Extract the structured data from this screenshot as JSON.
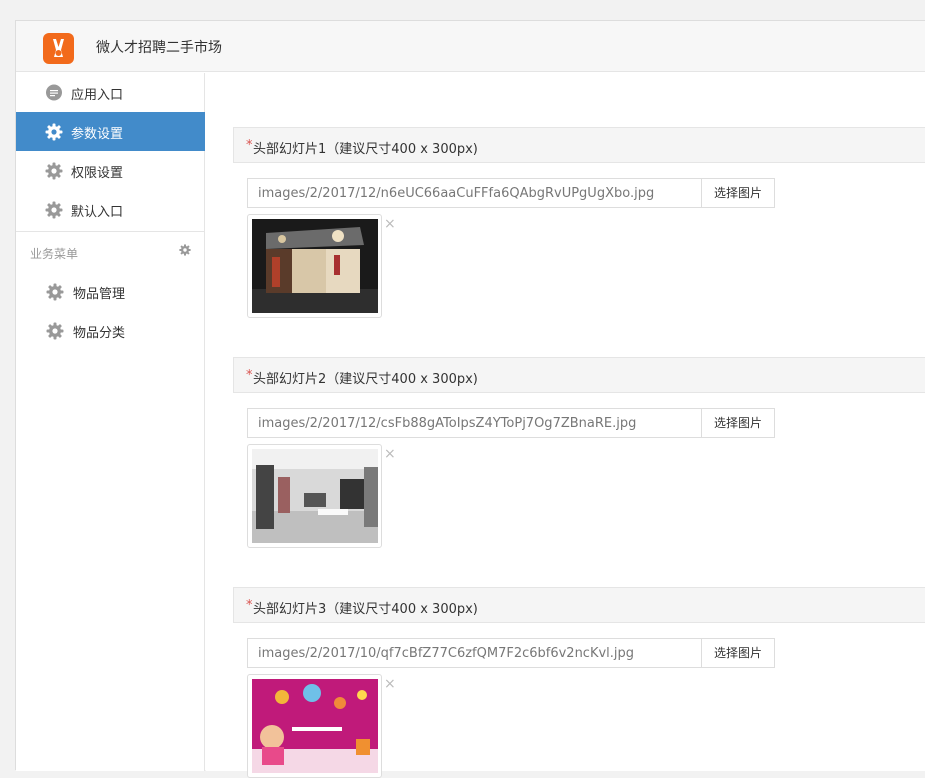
{
  "app": {
    "title": "微人才招聘二手市场"
  },
  "sidebar": {
    "items": [
      {
        "label": "应用入口",
        "icon": "chat-bubble-icon",
        "active": false
      },
      {
        "label": "参数设置",
        "icon": "gear-icon",
        "active": true
      },
      {
        "label": "权限设置",
        "icon": "gear-icon",
        "active": false
      },
      {
        "label": "默认入口",
        "icon": "gear-icon",
        "active": false
      }
    ],
    "section_title": "业务菜单",
    "business_items": [
      {
        "label": "物品管理",
        "icon": "gear-icon"
      },
      {
        "label": "物品分类",
        "icon": "gear-icon"
      }
    ]
  },
  "slides": [
    {
      "required_mark": "*",
      "title": "头部幻灯片1（建议尺寸400 x 300px)",
      "path": "images/2/2017/12/n6eUC66aaCuFFfa6QAbgRvUPgUgXbo.jpg",
      "button": "选择图片",
      "remove": "×"
    },
    {
      "required_mark": "*",
      "title": "头部幻灯片2（建议尺寸400 x 300px)",
      "path": "images/2/2017/12/csFb88gAToIpsZ4YToPj7Og7ZBnaRE.jpg",
      "button": "选择图片",
      "remove": "×"
    },
    {
      "required_mark": "*",
      "title": "头部幻灯片3（建议尺寸400 x 300px)",
      "path": "images/2/2017/10/qf7cBfZ77C6zfQM7F2c6bf6v2ncKvl.jpg",
      "button": "选择图片",
      "remove": "×"
    }
  ],
  "colors": {
    "accent": "#428bca",
    "logo": "#f26a1b",
    "required": "#d9534f"
  }
}
